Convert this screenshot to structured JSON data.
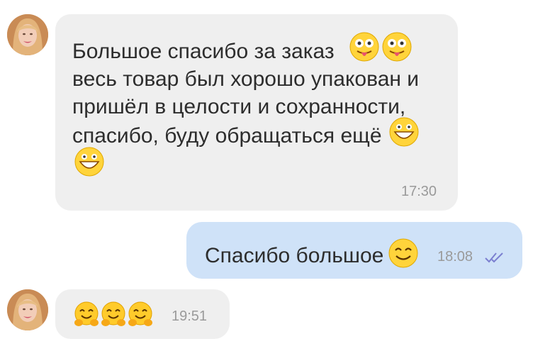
{
  "messages": [
    {
      "direction": "incoming",
      "lines": [
        "Большое спасибо за заказ",
        "весь товар был хорошо упакован и",
        "пришёл в целости и сохранности,",
        "спасибо, буду обращаться ещё"
      ],
      "emojis": [
        "tongue-out-face-icon",
        "tongue-out-face-icon",
        "grinning-face-icon",
        "grinning-face-icon"
      ],
      "time": "17:30"
    },
    {
      "direction": "outgoing",
      "text": "Спасибо большое",
      "emojis": [
        "smiling-face-icon"
      ],
      "time": "18:08",
      "status": "read-double-check-icon"
    },
    {
      "direction": "incoming",
      "text": "",
      "emojis": [
        "hugging-face-icon",
        "hugging-face-icon",
        "hugging-face-icon"
      ],
      "time": "19:51"
    }
  ],
  "colors": {
    "incoming_bubble": "#efefef",
    "outgoing_bubble": "#cfe2f8",
    "time_text": "#9a9a9a",
    "read_check": "#7b7fd0"
  }
}
